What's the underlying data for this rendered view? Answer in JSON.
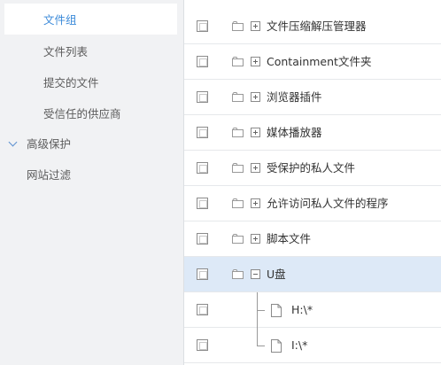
{
  "sidebar": {
    "items": [
      {
        "label": "文件组",
        "active": true
      },
      {
        "label": "文件列表"
      },
      {
        "label": "提交的文件"
      },
      {
        "label": "受信任的供应商"
      },
      {
        "label": "高级保护",
        "expanded": true
      },
      {
        "label": "网站过滤"
      }
    ]
  },
  "tree": {
    "rows": [
      {
        "label": "文件压缩解压管理器",
        "expanded": false
      },
      {
        "label": "Containment文件夹",
        "expanded": false
      },
      {
        "label": "浏览器插件",
        "expanded": false
      },
      {
        "label": "媒体播放器",
        "expanded": false
      },
      {
        "label": "受保护的私人文件",
        "expanded": false
      },
      {
        "label": "允许访问私人文件的程序",
        "expanded": false
      },
      {
        "label": "脚本文件",
        "expanded": false
      },
      {
        "label": "U盘",
        "expanded": true,
        "selected": true
      },
      {
        "label": "H:\\*",
        "child": true
      },
      {
        "label": "I:\\*",
        "child": true
      }
    ]
  },
  "colors": {
    "active_text": "#3b8ad9",
    "selected_row": "#dde9f7",
    "sidebar_bg": "#f1f2f4"
  }
}
